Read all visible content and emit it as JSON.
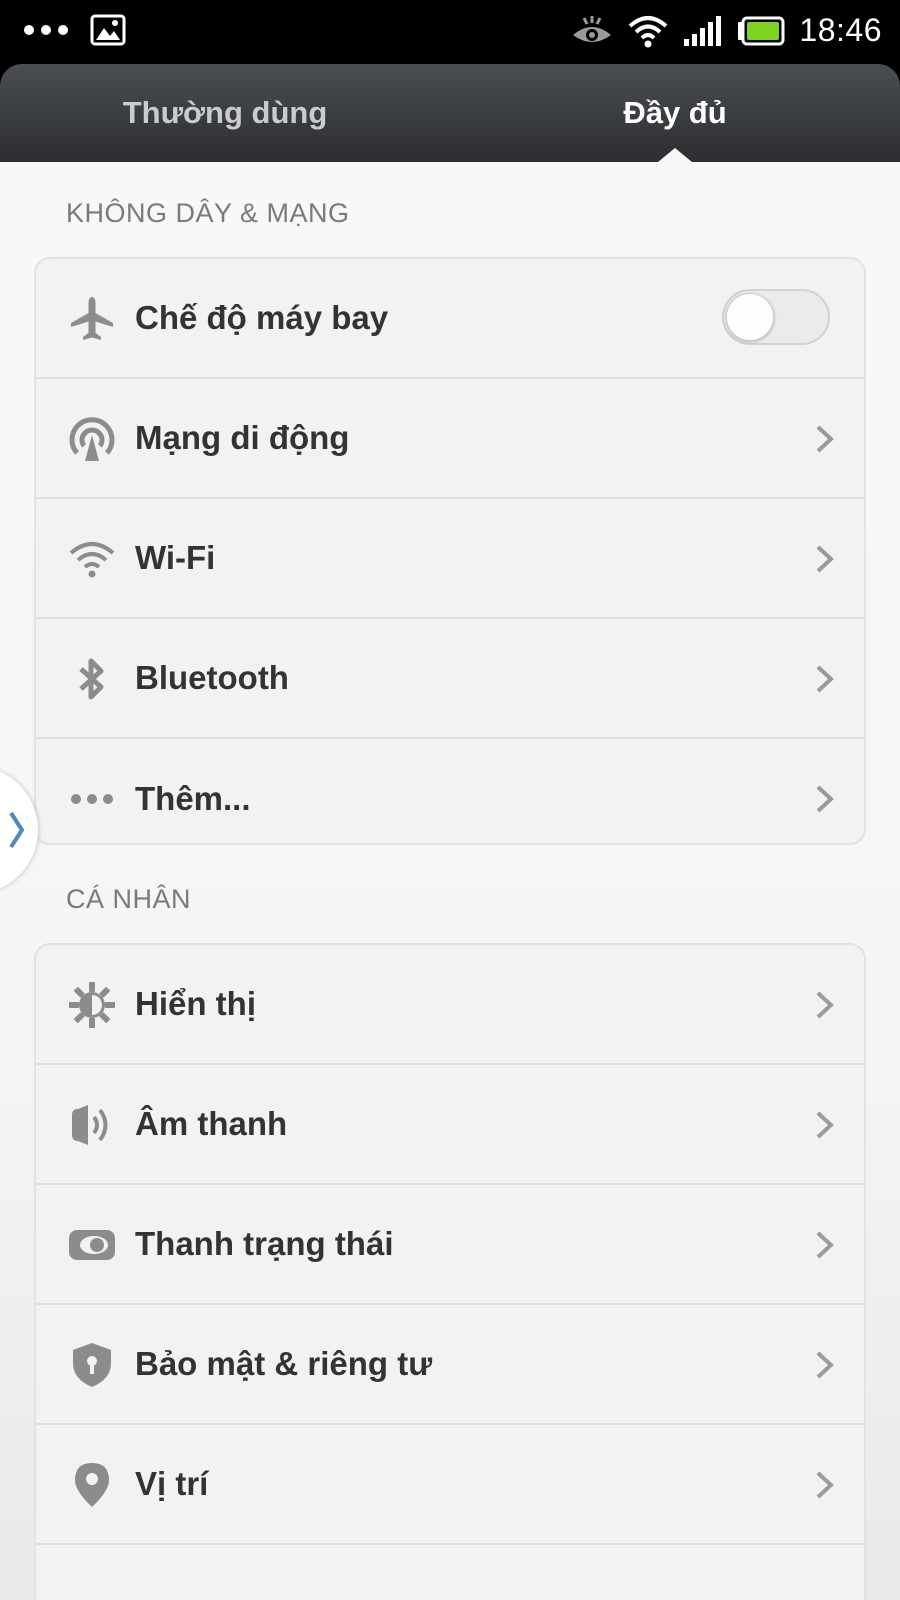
{
  "status_bar": {
    "time": "18:46",
    "icons": [
      "more-dots-icon",
      "gallery-icon",
      "eye-icon",
      "wifi-icon",
      "signal-icon",
      "battery-icon"
    ]
  },
  "tabs": [
    {
      "label": "Thường dùng",
      "selected": false
    },
    {
      "label": "Đầy đủ",
      "selected": true
    }
  ],
  "sections": [
    {
      "title": "KHÔNG DÂY & MẠNG",
      "items": [
        {
          "label": "Chế độ máy bay",
          "icon": "airplane-icon",
          "control": "toggle",
          "on": false
        },
        {
          "label": "Mạng di động",
          "icon": "cellular-network-icon",
          "control": "chevron"
        },
        {
          "label": "Wi-Fi",
          "icon": "wifi-icon",
          "control": "chevron"
        },
        {
          "label": "Bluetooth",
          "icon": "bluetooth-icon",
          "control": "chevron"
        },
        {
          "label": "Thêm...",
          "icon": "more-icon",
          "control": "chevron"
        }
      ]
    },
    {
      "title": "CÁ NHÂN",
      "items": [
        {
          "label": "Hiển thị",
          "icon": "brightness-icon",
          "control": "chevron"
        },
        {
          "label": "Âm thanh",
          "icon": "sound-icon",
          "control": "chevron"
        },
        {
          "label": "Thanh trạng thái",
          "icon": "status-bar-icon",
          "control": "chevron"
        },
        {
          "label": "Bảo mật & riêng tư",
          "icon": "shield-icon",
          "control": "chevron"
        },
        {
          "label": "Vị trí",
          "icon": "location-pin-icon",
          "control": "chevron"
        }
      ]
    }
  ],
  "colors": {
    "header_top": "#4a4d52",
    "header_bottom": "#2c2e31",
    "icon_gray": "#8a8c8e",
    "label_dark": "#333333",
    "section_gray": "#7a7a7a",
    "edge_handle_arrow": "#4a8bb8"
  }
}
